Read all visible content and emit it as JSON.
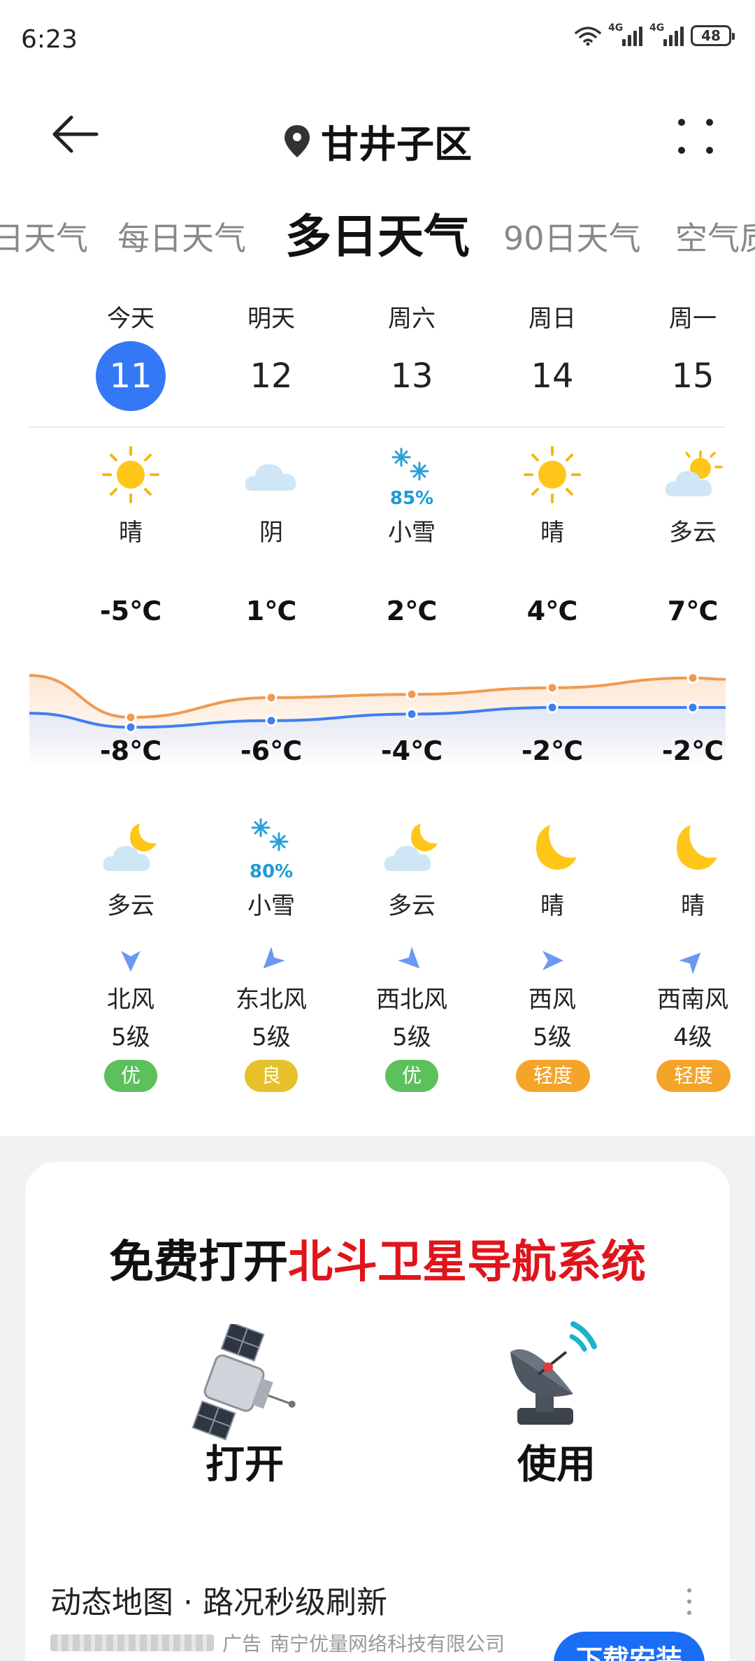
{
  "status_bar": {
    "time": "6:23",
    "network_1": "4G",
    "network_2": "4G",
    "battery": "48"
  },
  "header": {
    "location": "甘井子区"
  },
  "tabs": [
    "日天气",
    "每日天气",
    "多日天气",
    "90日天气",
    "空气质"
  ],
  "active_tab": "多日天气",
  "days": [
    {
      "weekday": "今天",
      "date": "11",
      "day_condition": "晴",
      "day_icon": "sun-icon",
      "day_precip": "",
      "high": "-5℃",
      "low": "-8℃",
      "night_condition": "多云",
      "night_icon": "cloudy-night-icon",
      "night_precip": "",
      "wind_dir": "北风",
      "wind_level": "5级",
      "aqi": "优",
      "aqi_color": "#5cc05c"
    },
    {
      "weekday": "明天",
      "date": "12",
      "day_condition": "阴",
      "day_icon": "overcast-icon",
      "day_precip": "",
      "high": "1℃",
      "low": "-6℃",
      "night_condition": "小雪",
      "night_icon": "snow-icon",
      "night_precip": "80%",
      "wind_dir": "东北风",
      "wind_level": "5级",
      "aqi": "良",
      "aqi_color": "#e6c12a"
    },
    {
      "weekday": "周六",
      "date": "13",
      "day_condition": "小雪",
      "day_icon": "snow-icon",
      "day_precip": "85%",
      "high": "2℃",
      "low": "-4℃",
      "night_condition": "多云",
      "night_icon": "cloudy-night-icon",
      "night_precip": "",
      "wind_dir": "西北风",
      "wind_level": "5级",
      "aqi": "优",
      "aqi_color": "#5cc05c"
    },
    {
      "weekday": "周日",
      "date": "14",
      "day_condition": "晴",
      "day_icon": "sun-icon",
      "day_precip": "",
      "high": "4℃",
      "low": "-2℃",
      "night_condition": "晴",
      "night_icon": "moon-icon",
      "night_precip": "",
      "wind_dir": "西风",
      "wind_level": "5级",
      "aqi": "轻度",
      "aqi_color": "#f5a42a"
    },
    {
      "weekday": "周一",
      "date": "15",
      "day_condition": "多云",
      "day_icon": "partly-cloudy-icon",
      "day_precip": "",
      "high": "7℃",
      "low": "-2℃",
      "night_condition": "晴",
      "night_icon": "moon-icon",
      "night_precip": "",
      "wind_dir": "西南风",
      "wind_level": "4级",
      "aqi": "轻度",
      "aqi_color": "#f5a42a"
    }
  ],
  "chart_data": {
    "type": "line",
    "categories": [
      "今天",
      "明天",
      "周六",
      "周日",
      "周一"
    ],
    "series": [
      {
        "values": [
          -5,
          1,
          2,
          4,
          7
        ],
        "color": "#f09a50"
      },
      {
        "values": [
          -8,
          -6,
          -4,
          -2,
          -2
        ],
        "color": "#3f7ff0"
      }
    ]
  },
  "ad": {
    "headline_black": "免费打开",
    "headline_red": "北斗卫星导航系统",
    "label_left": "打开",
    "label_right": "使用",
    "title": "动态地图 · 路况秒级刷新",
    "ad_tag": "广告",
    "company": "南宁优量网络科技有限公司",
    "button": "下载安装"
  }
}
